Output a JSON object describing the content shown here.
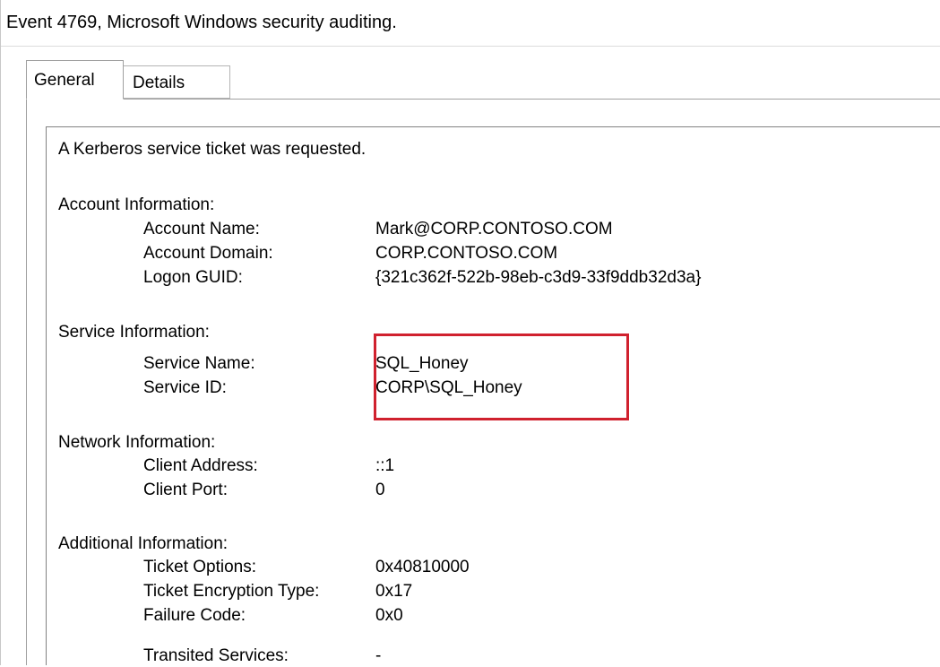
{
  "window": {
    "title": "Event 4769, Microsoft Windows security auditing."
  },
  "tabs": [
    {
      "label": "General",
      "selected": true
    },
    {
      "label": "Details",
      "selected": false
    }
  ],
  "event": {
    "summary": "A Kerberos service ticket was requested.",
    "account": {
      "heading": "Account Information:",
      "name_label": "Account Name:",
      "name_value": "Mark@CORP.CONTOSO.COM",
      "domain_label": "Account Domain:",
      "domain_value": "CORP.CONTOSO.COM",
      "guid_label": "Logon GUID:",
      "guid_value": "{321c362f-522b-98eb-c3d9-33f9ddb32d3a}"
    },
    "service": {
      "heading": "Service Information:",
      "name_label": "Service Name:",
      "name_value": "SQL_Honey",
      "id_label": "Service ID:",
      "id_value": "CORP\\SQL_Honey"
    },
    "network": {
      "heading": "Network Information:",
      "address_label": "Client Address:",
      "address_value": "::1",
      "port_label": "Client Port:",
      "port_value": "0"
    },
    "additional": {
      "heading": "Additional Information:",
      "options_label": "Ticket Options:",
      "options_value": "0x40810000",
      "encryption_label": "Ticket Encryption Type:",
      "encryption_value": "0x17",
      "failure_label": "Failure Code:",
      "failure_value": "0x0",
      "transited_label": "Transited Services:",
      "transited_value": "-"
    }
  },
  "colors": {
    "highlight": "#d0212e"
  }
}
